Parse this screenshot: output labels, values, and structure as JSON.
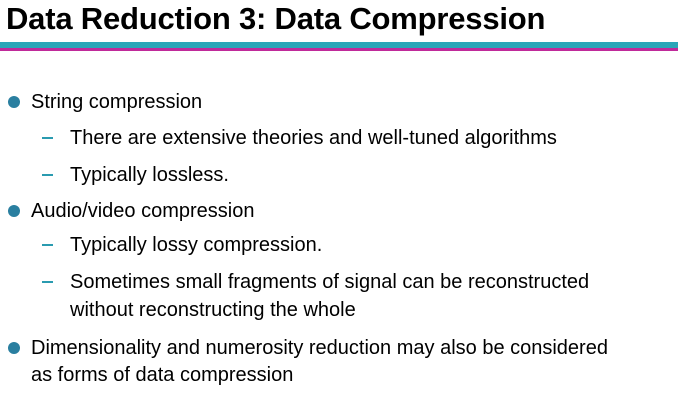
{
  "title": "Data Reduction 3: Data Compression",
  "colors": {
    "accent_teal": "#2aa6b8",
    "accent_magenta": "#c02a9a",
    "bullet": "#2a7fa0",
    "dash": "#2a9bb0"
  },
  "bullets": [
    {
      "text": "String compression",
      "subitems": [
        {
          "lines": [
            "There are extensive theories and well-tuned algorithms"
          ]
        },
        {
          "lines": [
            "Typically lossless."
          ]
        }
      ]
    },
    {
      "text": "Audio/video compression",
      "subitems": [
        {
          "lines": [
            "Typically lossy compression."
          ]
        },
        {
          "lines": [
            "Sometimes small fragments of signal can be reconstructed",
            "without reconstructing the whole"
          ]
        }
      ]
    },
    {
      "lines": [
        "Dimensionality and numerosity reduction may also be considered",
        "as forms of data compression"
      ]
    }
  ]
}
